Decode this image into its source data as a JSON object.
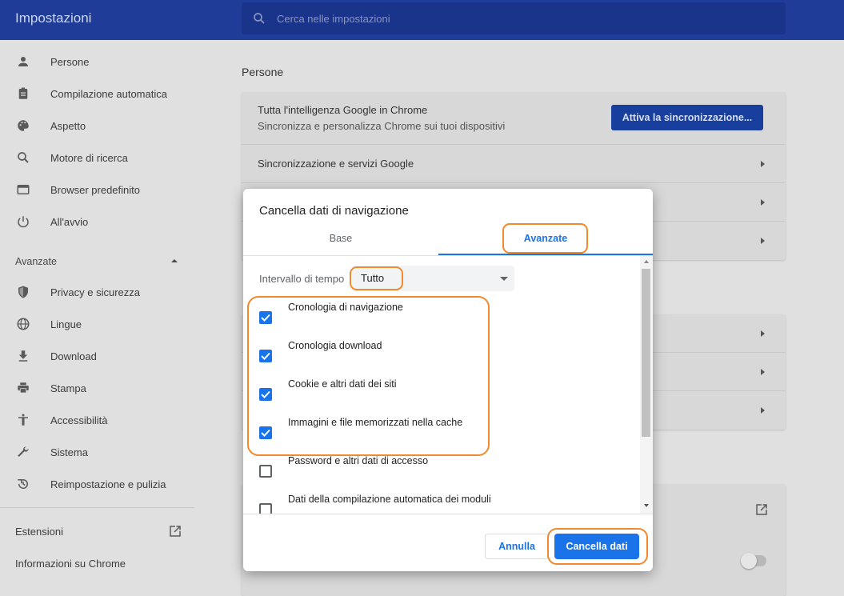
{
  "header": {
    "title": "Impostazioni",
    "search_placeholder": "Cerca nelle impostazioni"
  },
  "sidebar": {
    "items": [
      {
        "label": "Persone",
        "icon": "person-icon"
      },
      {
        "label": "Compilazione automatica",
        "icon": "clipboard-icon"
      },
      {
        "label": "Aspetto",
        "icon": "palette-icon"
      },
      {
        "label": "Motore di ricerca",
        "icon": "search-icon"
      },
      {
        "label": "Browser predefinito",
        "icon": "browser-icon"
      },
      {
        "label": "All'avvio",
        "icon": "power-icon"
      }
    ],
    "advanced_label": "Avanzate",
    "advanced_items": [
      {
        "label": "Privacy e sicurezza",
        "icon": "shield-icon"
      },
      {
        "label": "Lingue",
        "icon": "globe-icon"
      },
      {
        "label": "Download",
        "icon": "download-icon"
      },
      {
        "label": "Stampa",
        "icon": "print-icon"
      },
      {
        "label": "Accessibilità",
        "icon": "accessibility-icon"
      },
      {
        "label": "Sistema",
        "icon": "wrench-icon"
      },
      {
        "label": "Reimpostazione e pulizia",
        "icon": "restore-icon"
      }
    ],
    "extensions_label": "Estensioni",
    "about_label": "Informazioni su Chrome"
  },
  "main": {
    "section_title": "Persone",
    "sync_title": "Tutta l'intelligenza Google in Chrome",
    "sync_subtitle": "Sincronizza e personalizza Chrome sui tuoi dispositivi",
    "sync_button": "Attiva la sincronizzazione...",
    "sync_services": "Sincronizzazione e servizi Google"
  },
  "dialog": {
    "title": "Cancella dati di navigazione",
    "tabs": [
      {
        "label": "Base",
        "active": false
      },
      {
        "label": "Avanzate",
        "active": true
      }
    ],
    "time_range_label": "Intervallo di tempo",
    "time_range_value": "Tutto",
    "options": [
      {
        "label": "Cronologia di navigazione",
        "checked": true
      },
      {
        "label": "Cronologia download",
        "checked": true
      },
      {
        "label": "Cookie e altri dati dei siti",
        "checked": true
      },
      {
        "label": "Immagini e file memorizzati nella cache",
        "checked": true
      },
      {
        "label": "Password e altri dati di accesso",
        "checked": false
      },
      {
        "label": "Dati della compilazione automatica dei moduli",
        "checked": false
      }
    ],
    "cancel_button": "Annulla",
    "clear_button": "Cancella dati"
  },
  "colors": {
    "header_bg": "#1f3d98",
    "accent": "#1a73e8",
    "annotation": "#f08a2c"
  }
}
